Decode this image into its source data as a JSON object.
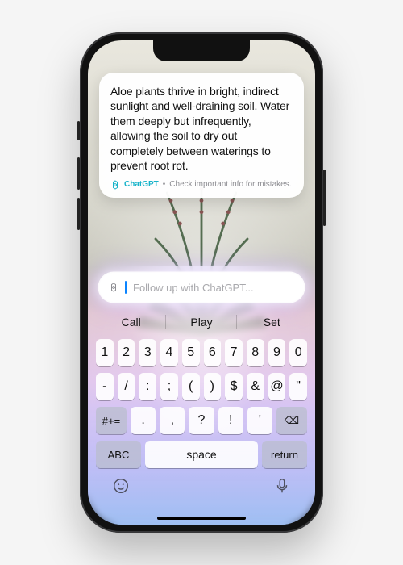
{
  "response": {
    "text": "Aloe plants thrive in bright, indirect sunlight and well-draining soil. Water them deeply but infrequently, allowing the soil to dry out completely between waterings to prevent root rot.",
    "source_label": "ChatGPT",
    "disclaimer": "Check important info for mistakes."
  },
  "input": {
    "placeholder": "Follow up with ChatGPT..."
  },
  "suggestions": [
    "Call",
    "Play",
    "Set"
  ],
  "keyboard": {
    "row1": [
      "1",
      "2",
      "3",
      "4",
      "5",
      "6",
      "7",
      "8",
      "9",
      "0"
    ],
    "row2": [
      "-",
      "/",
      ":",
      ";",
      "(",
      ")",
      "$",
      "&",
      "@",
      "\""
    ],
    "row3_left": "#+=",
    "row3_mid": [
      ".",
      ",",
      "?",
      "!",
      "'"
    ],
    "row3_right": "⌫",
    "row4_left": "ABC",
    "row4_space": "space",
    "row4_right": "return"
  },
  "icons": {
    "chatgpt": "chatgpt-logo-icon",
    "emoji": "emoji-icon",
    "mic": "mic-icon"
  }
}
